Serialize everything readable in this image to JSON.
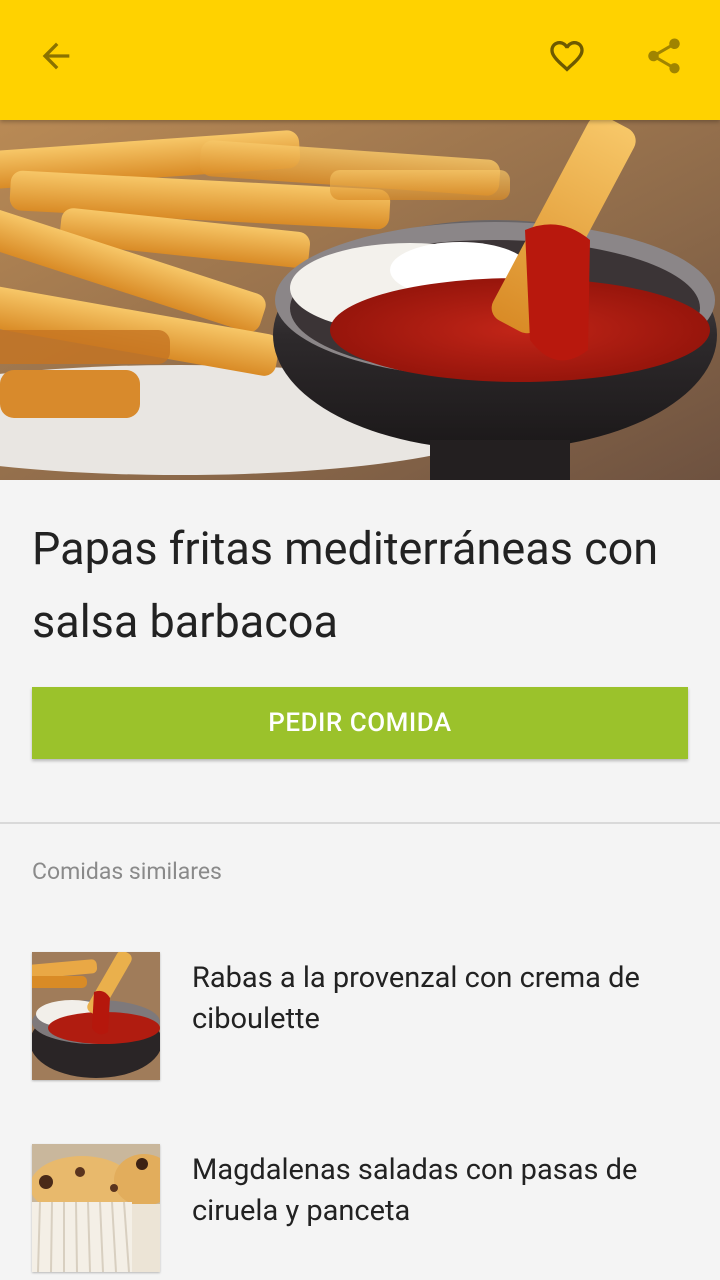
{
  "toolbar": {
    "background": "#ffd200",
    "icons": [
      "arrow-back-icon",
      "heart-outline-icon",
      "share-icon"
    ]
  },
  "recipe": {
    "title": "Papas fritas mediterráneas con salsa barbacoa",
    "image": "fries-with-ketchup-photo"
  },
  "order_button": {
    "label": "PEDIR COMIDA",
    "color": "#9bc22b"
  },
  "similar": {
    "heading": "Comidas similares",
    "items": [
      {
        "title": "Rabas a la provenzal con crema de ciboulette",
        "image": "fries-ketchup-thumb"
      },
      {
        "title": "Magdalenas saladas con pasas de ciruela y panceta",
        "image": "muffins-thumb"
      }
    ]
  }
}
